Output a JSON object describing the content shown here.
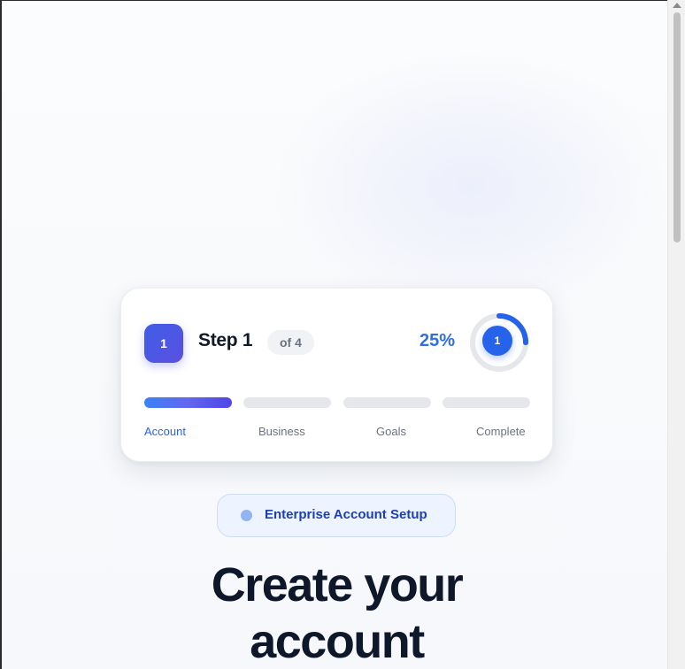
{
  "progress": {
    "current_step": "1",
    "step_title": "Step 1",
    "step_of": "of 4",
    "percent_label": "25%",
    "percent_value": 0.25,
    "ring_step": "1",
    "accent_color": "#2563eb",
    "steps": [
      {
        "label": "Account",
        "active": true
      },
      {
        "label": "Business",
        "active": false
      },
      {
        "label": "Goals",
        "active": false
      },
      {
        "label": "Complete",
        "active": false
      }
    ]
  },
  "badge": {
    "text": "Enterprise Account Setup",
    "icon": "dot-icon"
  },
  "heading": {
    "line1": "Create your",
    "line2": "account"
  }
}
